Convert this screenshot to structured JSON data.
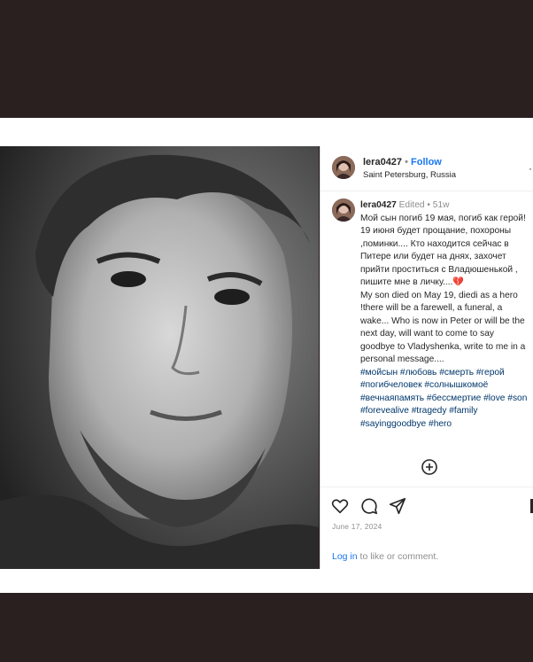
{
  "post": {
    "header": {
      "username": "lera0427",
      "separator": "•",
      "follow_label": "Follow",
      "location": "Saint Petersburg, Russia"
    },
    "caption": {
      "username": "lera0427",
      "edited": "Edited",
      "separator": "•",
      "age": "51w",
      "russian_text": "Мой сын погиб 19 мая, погиб как герой! 19 июня будет прощание, похороны ,поминки.... Кто находится сейчас в Питере или будет на днях, захочет прийти проститься с Владюшенькой , пишите мне в личку....",
      "emoji": "💔",
      "english_text": "My son died on May 19, diedi as a hero !there will be a farewell, a funeral, a wake... Who is now in Peter or will be the next day, will want to come to say goodbye to Vladyshenka, write to me in a personal message....",
      "hashtags": "#мойсын #любовь #смерть #герой #погибчеловек #солнышкомоё #вечнаяпамять #бессмертие #love #son #forevealive #tragedy #family #sayinggoodbye #hero"
    },
    "date": "June 17, 2024",
    "login_prompt": {
      "link": "Log in",
      "text": " to like or comment."
    },
    "icons": {
      "like": "heart-icon",
      "comment": "comment-icon",
      "share": "share-icon",
      "more_comments": "plus-circle-icon",
      "save": "bookmark-icon"
    }
  }
}
